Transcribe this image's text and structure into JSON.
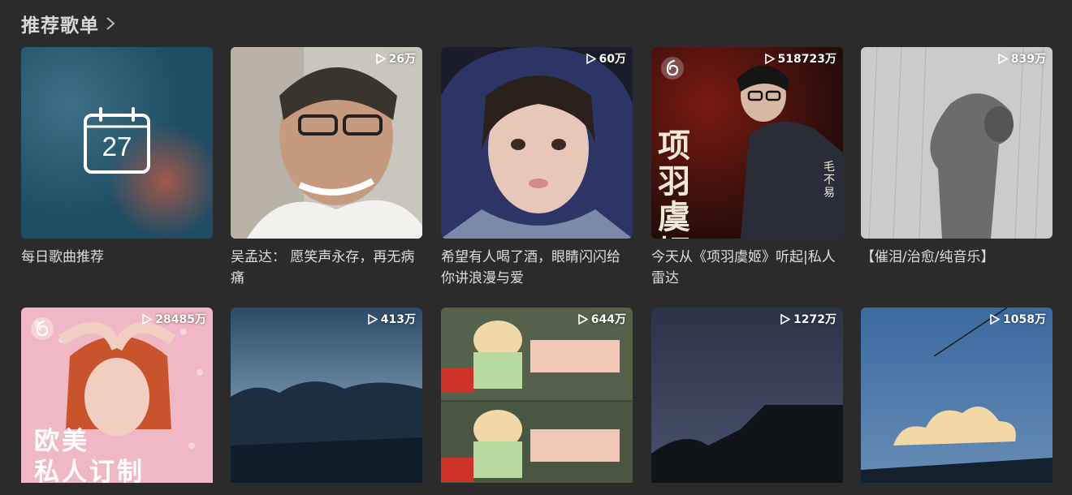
{
  "section": {
    "title": "推荐歌单"
  },
  "daily": {
    "day": "27",
    "name": "每日歌曲推荐"
  },
  "playlists_row1": [
    {
      "plays": "26万",
      "name": "吴孟达： 愿笑声永存，再无病痛"
    },
    {
      "plays": "60万",
      "name": "希望有人喝了酒，眼睛闪闪给你讲浪漫与爱"
    },
    {
      "plays": "518723万",
      "name": "今天从《项羽虞姬》听起|私人雷达",
      "cover_text_vertical": "项羽虞姬",
      "cover_artist": "毛不易"
    },
    {
      "plays": "839万",
      "name": "【催泪/治愈/纯音乐】"
    }
  ],
  "playlists_row2": [
    {
      "plays": "28485万",
      "cover_text": [
        "欧美",
        "私人订制"
      ]
    },
    {
      "plays": "413万"
    },
    {
      "plays": "644万"
    },
    {
      "plays": "1272万"
    },
    {
      "plays": "1058万"
    }
  ],
  "colors": {
    "background": "#2b2b2b",
    "text": "#dddddd",
    "accent": "#ec4141"
  }
}
